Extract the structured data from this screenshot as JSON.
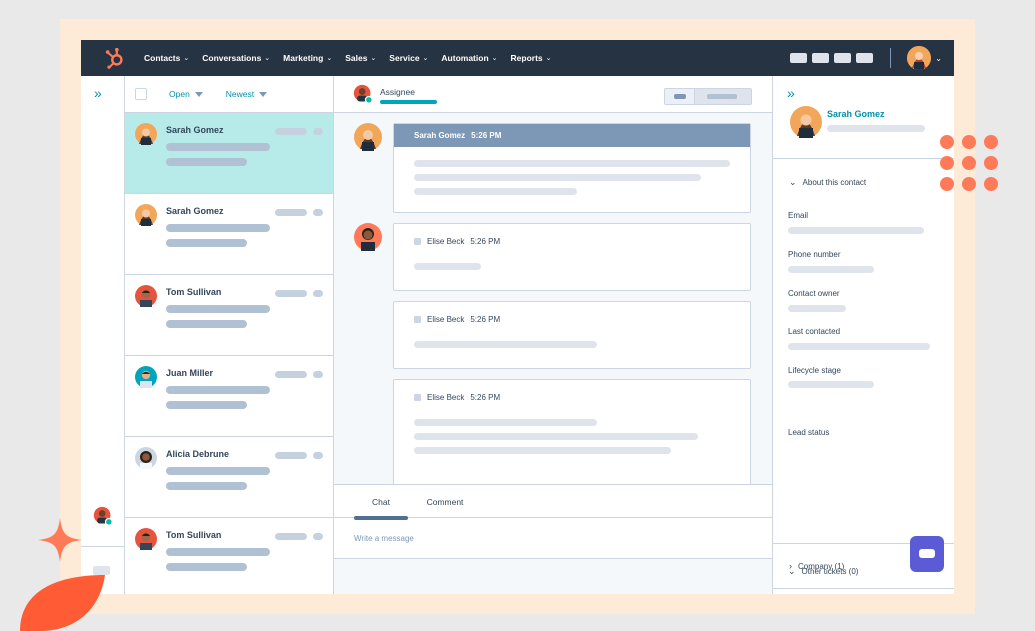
{
  "nav": {
    "items": [
      {
        "label": "Contacts"
      },
      {
        "label": "Conversations"
      },
      {
        "label": "Marketing"
      },
      {
        "label": "Sales"
      },
      {
        "label": "Service"
      },
      {
        "label": "Automation"
      },
      {
        "label": "Reports"
      }
    ],
    "chevron": "⌄"
  },
  "list": {
    "filter_status": "Open",
    "filter_sort": "Newest",
    "rows": [
      {
        "name": "Sarah Gomez",
        "avatar": "avatar-sarah",
        "active": true
      },
      {
        "name": "Sarah Gomez",
        "avatar": "avatar-sarah",
        "active": false
      },
      {
        "name": "Tom Sullivan",
        "avatar": "avatar-tom",
        "active": false
      },
      {
        "name": "Juan Miller",
        "avatar": "avatar-juan",
        "active": false
      },
      {
        "name": "Alicia Debrune",
        "avatar": "avatar-alicia",
        "active": false
      },
      {
        "name": "Tom Sullivan",
        "avatar": "avatar-tom",
        "active": false
      }
    ]
  },
  "chat": {
    "assignee_label": "Assignee",
    "messages": [
      {
        "author": "Sarah Gomez",
        "time": "5:26 PM"
      },
      {
        "author": "Elise Beck",
        "time": "5:26 PM"
      },
      {
        "author": "Elise Beck",
        "time": "5:26 PM"
      },
      {
        "author": "Elise Beck",
        "time": "5:26 PM"
      }
    ],
    "tabs": [
      {
        "label": "Chat"
      },
      {
        "label": "Comment"
      }
    ],
    "composer_placeholder": "Write a message"
  },
  "contact": {
    "name": "Sarah Gomez",
    "about_title": "About this contact",
    "fields": [
      {
        "label": "Email"
      },
      {
        "label": "Phone number"
      },
      {
        "label": "Contact owner"
      },
      {
        "label": "Last contacted"
      },
      {
        "label": "Lifecycle stage"
      },
      {
        "label": "Lead status"
      }
    ],
    "company_label": "Company (1)",
    "tickets_label": "Other tickets (0)"
  },
  "colors": {
    "nav_bg": "#253342",
    "accent": "#ff7a59",
    "teal": "#00a4bd",
    "active_row": "#b7ebe9",
    "link": "#0091ae"
  }
}
